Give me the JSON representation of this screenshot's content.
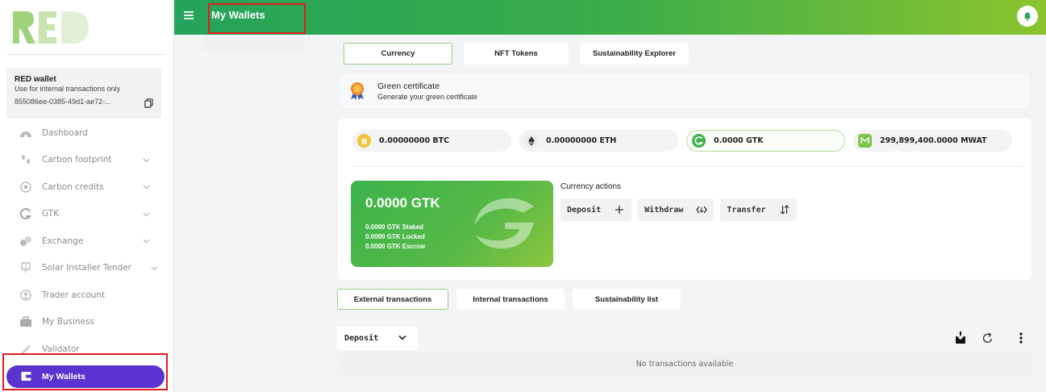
{
  "sidebar": {
    "logo_text": "RED",
    "wallet": {
      "title": "RED wallet",
      "subtitle": "Use for internal transactions only",
      "id": "855086ee-0385-49d1-ae72-..."
    },
    "items": [
      {
        "label": "Dashboard",
        "icon": "dashboard-icon"
      },
      {
        "label": "Carbon footprint",
        "icon": "footprint-icon"
      },
      {
        "label": "Carbon credits",
        "icon": "credits-icon"
      },
      {
        "label": "GTK",
        "icon": "gtk-icon"
      },
      {
        "label": "Exchange",
        "icon": "exchange-icon"
      },
      {
        "label": "Solar Installer Tender",
        "icon": "solar-panel-icon"
      },
      {
        "label": "Trader account",
        "icon": "trader-icon"
      },
      {
        "label": "My Business",
        "icon": "briefcase-icon"
      },
      {
        "label": "Validator",
        "icon": "validator-icon"
      },
      {
        "label": "My Wallets",
        "icon": "wallet-icon"
      }
    ]
  },
  "header": {
    "title": "My Wallets"
  },
  "tabs": [
    "Currency",
    "NFT Tokens",
    "Sustainability Explorer"
  ],
  "certificate": {
    "title": "Green certificate",
    "subtitle": "Generate your green certificate"
  },
  "balances": [
    {
      "value": "0.00000000 BTC",
      "color": "#f5c33b"
    },
    {
      "value": "0.00000000 ETH",
      "color": "#e6e6e6"
    },
    {
      "value": "0.0000 GTK",
      "color": "#3bb34a"
    },
    {
      "value": "299,899,400.0000 MWAT",
      "color": "#7bc54a"
    }
  ],
  "gtk_card": {
    "amount": "0.0000 GTK",
    "staked": "0.0000 GTK Staked",
    "locked": "0.0000 GTK Locked",
    "escrow": "0.0000 GTK Escrow"
  },
  "currency_actions": {
    "title": "Currency actions",
    "deposit": "Deposit",
    "withdraw": "Withdraw",
    "transfer": "Transfer"
  },
  "tx_tabs": [
    "External transactions",
    "Internal transactions",
    "Sustainability list"
  ],
  "filter": {
    "selected": "Deposit"
  },
  "empty_text": "No transactions available",
  "colors": {
    "accent_purple": "#5b33d1",
    "green": "#3bb34a",
    "highlight_red": "#e21c1c"
  }
}
